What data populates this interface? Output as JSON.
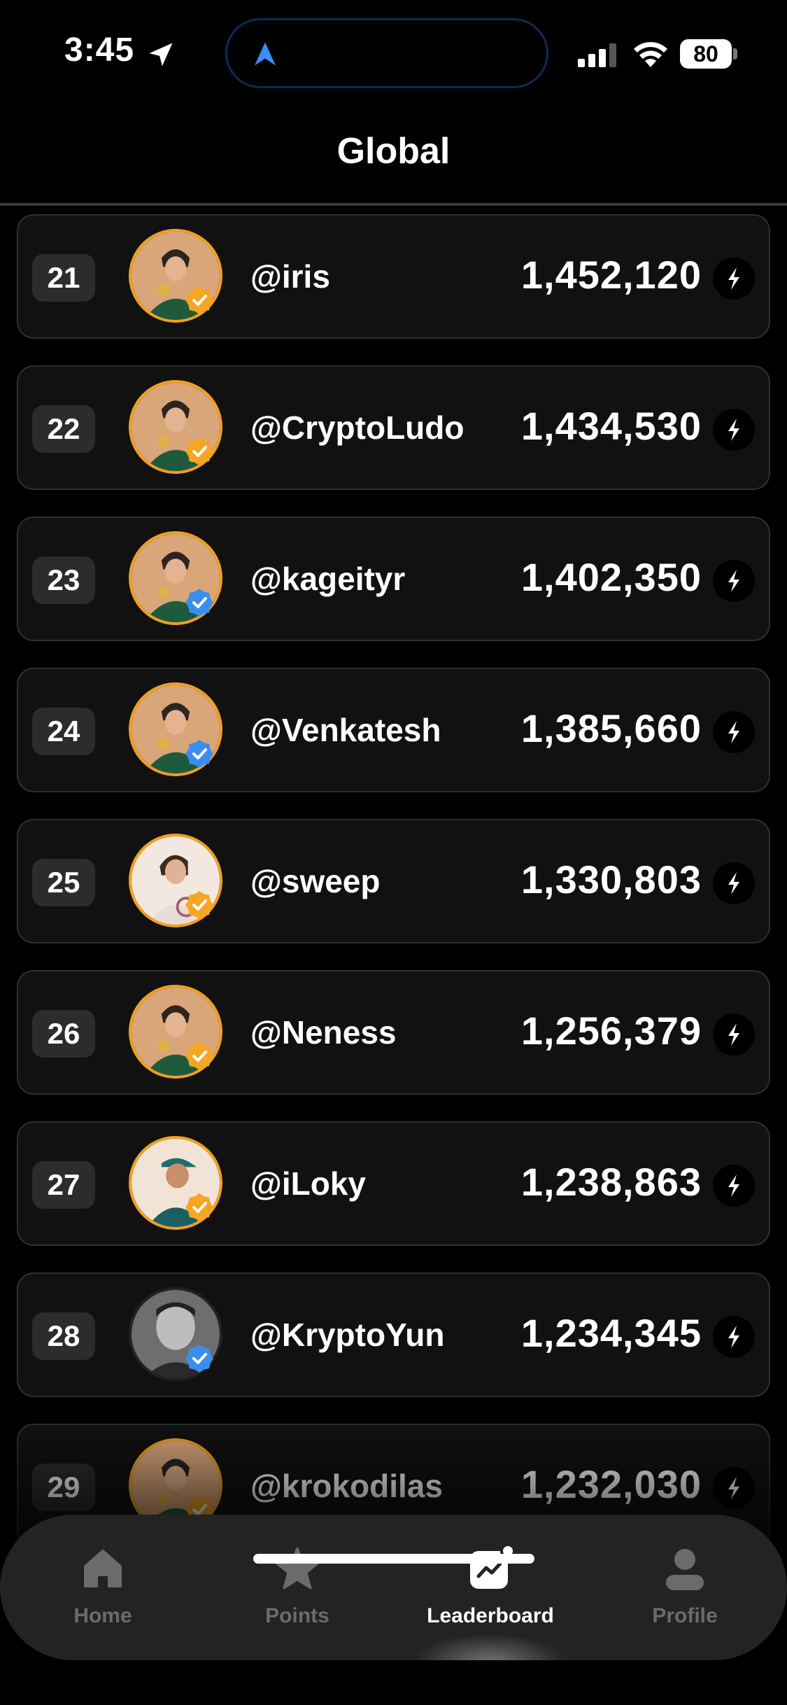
{
  "status": {
    "time": "3:45",
    "battery": "80"
  },
  "header": {
    "title": "Global"
  },
  "rows": [
    {
      "rank": "21",
      "username": "@iris",
      "score": "1,452,120",
      "badge": "gold",
      "avatar": "green-jacket"
    },
    {
      "rank": "22",
      "username": "@CryptoLudo",
      "score": "1,434,530",
      "badge": "gold",
      "avatar": "green-jacket"
    },
    {
      "rank": "23",
      "username": "@kageityr",
      "score": "1,402,350",
      "badge": "blue",
      "avatar": "green-jacket"
    },
    {
      "rank": "24",
      "username": "@Venkatesh",
      "score": "1,385,660",
      "badge": "blue",
      "avatar": "green-jacket"
    },
    {
      "rank": "25",
      "username": "@sweep",
      "score": "1,330,803",
      "badge": "gold",
      "avatar": "light-jacket"
    },
    {
      "rank": "26",
      "username": "@Neness",
      "score": "1,256,379",
      "badge": "gold",
      "avatar": "green-jacket"
    },
    {
      "rank": "27",
      "username": "@iLoky",
      "score": "1,238,863",
      "badge": "gold",
      "avatar": "cap-teal"
    },
    {
      "rank": "28",
      "username": "@KryptoYun",
      "score": "1,234,345",
      "badge": "blue",
      "avatar": "photo-gray"
    },
    {
      "rank": "29",
      "username": "@krokodilas",
      "score": "1,232,030",
      "badge": "gold",
      "avatar": "green-jacket"
    }
  ],
  "tabs": [
    {
      "label": "Home",
      "icon": "home-icon",
      "active": false
    },
    {
      "label": "Points",
      "icon": "star-icon",
      "active": false
    },
    {
      "label": "Leaderboard",
      "icon": "leaderboard-icon",
      "active": true
    },
    {
      "label": "Profile",
      "icon": "profile-icon",
      "active": false
    }
  ],
  "colors": {
    "background": "#000000",
    "card": "#111111",
    "gold_badge": "#f5a623",
    "blue_badge": "#3b8ef0"
  }
}
